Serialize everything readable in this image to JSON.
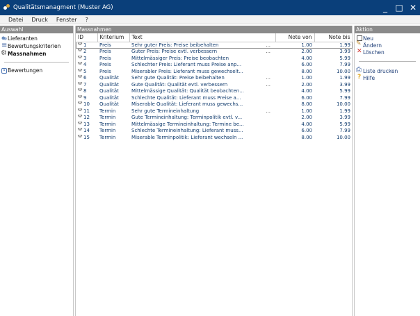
{
  "window": {
    "title": "Qualitätsmanagment (Muster AG)",
    "minimize": "_",
    "maximize": "□",
    "close": "✕"
  },
  "menu": [
    "Datei",
    "Druck",
    "Fenster",
    "?"
  ],
  "left_panel": {
    "header": "Auswahl",
    "items": [
      {
        "label": "Lieferanten",
        "icon": "users-icon"
      },
      {
        "label": "Bewertungskriterien",
        "icon": "list-icon"
      },
      {
        "label": "Massnahmen",
        "icon": "gear-icon",
        "active": true
      }
    ],
    "items2": [
      {
        "label": "Bewertungen",
        "icon": "rating-icon"
      }
    ]
  },
  "center_panel": {
    "header": "Massnahmen",
    "columns": [
      "ID",
      "Kriterium",
      "Text",
      "Note von",
      "Note bis"
    ],
    "rows": [
      {
        "id": "1",
        "kriterium": "Preis",
        "text": "Sehr guter Preis: Preise beibehalten",
        "ellipsis": "...",
        "von": "1.00",
        "bis": "1.99",
        "selected": true
      },
      {
        "id": "2",
        "kriterium": "Preis",
        "text": "Guter Preis: Preise evtl. verbessern",
        "ellipsis": "...",
        "von": "2.00",
        "bis": "3.99"
      },
      {
        "id": "3",
        "kriterium": "Preis",
        "text": "Mittelmässiger Preis: Preise beobachten",
        "ellipsis": "",
        "von": "4.00",
        "bis": "5.99"
      },
      {
        "id": "4",
        "kriterium": "Preis",
        "text": "Schlechter Preis: Lieferant muss Preise anp...",
        "ellipsis": "",
        "von": "6.00",
        "bis": "7.99"
      },
      {
        "id": "5",
        "kriterium": "Preis",
        "text": "Miserabler Preis: Lieferant muss gewechselt...",
        "ellipsis": "",
        "von": "8.00",
        "bis": "10.00"
      },
      {
        "id": "6",
        "kriterium": "Qualität",
        "text": "Sehr gute Qualität: Preise beibehalten",
        "ellipsis": "...",
        "von": "1.00",
        "bis": "1.99"
      },
      {
        "id": "7",
        "kriterium": "Qualität",
        "text": "Gute Qualität: Qualität evtl. verbessern",
        "ellipsis": "...",
        "von": "2.00",
        "bis": "3.99"
      },
      {
        "id": "8",
        "kriterium": "Qualität",
        "text": "Mittelmässige Qualität: Qualität beobachten...",
        "ellipsis": "",
        "von": "4.00",
        "bis": "5.99"
      },
      {
        "id": "9",
        "kriterium": "Qualität",
        "text": "Schlechte Qualität: Lieferant muss Preise a...",
        "ellipsis": "",
        "von": "6.00",
        "bis": "7.99"
      },
      {
        "id": "10",
        "kriterium": "Qualität",
        "text": "Miserable Qualität: Lieferant muss gewechs...",
        "ellipsis": "",
        "von": "8.00",
        "bis": "10.00"
      },
      {
        "id": "11",
        "kriterium": "Termin",
        "text": "Sehr gute Termineinhaltung",
        "ellipsis": "...",
        "von": "1.00",
        "bis": "1.99"
      },
      {
        "id": "12",
        "kriterium": "Termin",
        "text": "Gute Termineinhaltung: Terminpolitik evtl. v...",
        "ellipsis": "",
        "von": "2.00",
        "bis": "3.99"
      },
      {
        "id": "13",
        "kriterium": "Termin",
        "text": "Mittelmässige Termineinhaltung: Termine be...",
        "ellipsis": "",
        "von": "4.00",
        "bis": "5.99"
      },
      {
        "id": "14",
        "kriterium": "Termin",
        "text": "Schlechte Termineinhaltung: Lieferant muss...",
        "ellipsis": "",
        "von": "6.00",
        "bis": "7.99"
      },
      {
        "id": "15",
        "kriterium": "Termin",
        "text": "Miserable Terminpolitik: Lieferant wechseln ...",
        "ellipsis": "",
        "von": "8.00",
        "bis": "10.00"
      }
    ]
  },
  "right_panel": {
    "header": "Aktion",
    "actions": [
      {
        "label": "Neu",
        "icon": "new-icon"
      },
      {
        "label": "Ändern",
        "icon": "edit-icon"
      },
      {
        "label": "Löschen",
        "icon": "delete-icon"
      }
    ],
    "actions2": [
      {
        "label": "Liste drucken",
        "icon": "print-icon"
      },
      {
        "label": "Hilfe",
        "icon": "help-icon"
      }
    ]
  },
  "colors": {
    "titlebar": "#0a3f7a",
    "panel_header": "#8a8a8a",
    "row_text": "#123c6e"
  }
}
